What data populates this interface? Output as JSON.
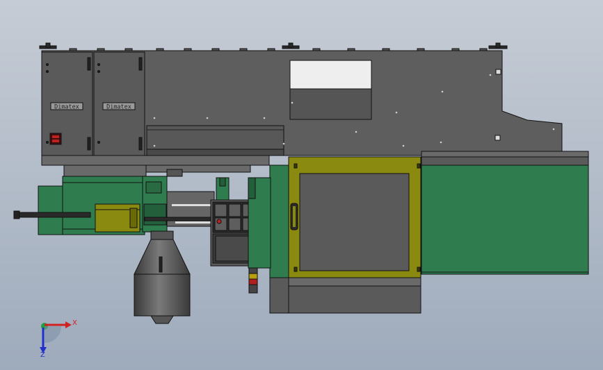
{
  "viewport": {
    "background_top": "#c6ccd5",
    "background_bottom": "#9eabbc"
  },
  "machine": {
    "nameplate_left": "Dimatex",
    "nameplate_right": "Dimatex",
    "colors": {
      "body_gray": "#5e5e5e",
      "body_gray_dark": "#4a4a4a",
      "edge": "#111111",
      "green": "#2f7d4f",
      "green_dark": "#245f3c",
      "olive": "#8a8a10",
      "olive_dark": "#5e5e0a"
    }
  },
  "triad": {
    "x_label": "X",
    "z_label": "Z",
    "x_color": "#d12020",
    "z_color": "#2030c8",
    "y_color": "#20a040"
  }
}
